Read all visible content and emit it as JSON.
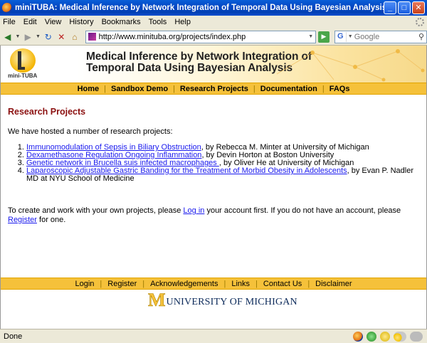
{
  "window": {
    "title": "miniTUBA: Medical Inference by Network Integration of Temporal Data Using Bayesian Analysis - Mozilla Firefox"
  },
  "menu": [
    "File",
    "Edit",
    "View",
    "History",
    "Bookmarks",
    "Tools",
    "Help"
  ],
  "address": {
    "url": "http://www.minituba.org/projects/index.php"
  },
  "search": {
    "engine": "G",
    "placeholder": "Google"
  },
  "banner": {
    "logo_label": "mini-TUBA",
    "title_line1": "Medical Inference by Network Integration of",
    "title_line2": "Temporal Data Using Bayesian Analysis"
  },
  "nav": [
    "Home",
    "Sandbox Demo",
    "Research Projects",
    "Documentation",
    "FAQs"
  ],
  "page": {
    "heading": "Research Projects",
    "intro": "We have hosted a number of research projects:",
    "projects": [
      {
        "link": "Immunomodulation of Sepsis in Biliary Obstruction",
        "rest": ", by Rebecca M. Minter at University of Michigan"
      },
      {
        "link": "Dexamethasone Regulation Ongoing Inflammation",
        "rest": ", by Devin Horton at Boston University"
      },
      {
        "link": "Genetic network in Brucella suis infected macrophages ",
        "rest": ", by Oliver He at University of Michigan"
      },
      {
        "link": "Laparoscopic Adjustable Gastric Banding for the Treatment of Morbid Obesity in Adolescents",
        "rest": ", by Evan P. Nadler MD at NYU School of Medicine"
      }
    ],
    "login_pre": "To create and work with your own projects, please ",
    "login_link": "Log in",
    "login_mid": " your account first. If you do not have an account, please ",
    "register_link": "Register",
    "login_post": " for one."
  },
  "footer": {
    "nav": [
      "Login",
      "Register",
      "Acknowledgements",
      "Links",
      "Contact Us",
      "Disclaimer"
    ],
    "um_letter": "M",
    "um_text": "UNIVERSITY OF MICHIGAN"
  },
  "status": {
    "text": "Done"
  },
  "colors": {
    "accent_yellow": "#f5c13a",
    "heading_red": "#8b1010",
    "link_blue": "#1a1aee"
  }
}
